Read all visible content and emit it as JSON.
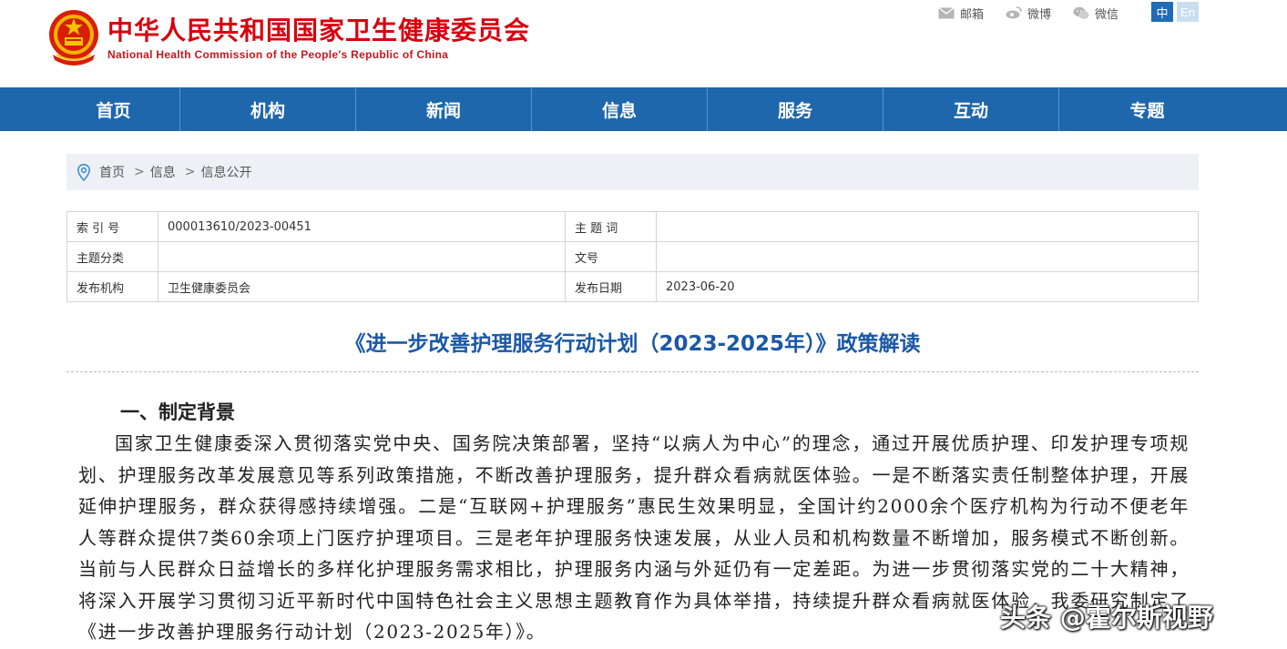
{
  "header": {
    "site_name_cn": "中华人民共和国国家卫生健康委员会",
    "site_name_en": "National Health Commission of the People′s Republic of China",
    "links": [
      {
        "label": "邮箱",
        "icon": "mail-icon"
      },
      {
        "label": "微博",
        "icon": "weibo-icon"
      },
      {
        "label": "微信",
        "icon": "wechat-icon"
      }
    ],
    "lang": {
      "zh": "中",
      "en": "En"
    }
  },
  "nav": [
    "首页",
    "机构",
    "新闻",
    "信息",
    "服务",
    "互动",
    "专题"
  ],
  "breadcrumb": {
    "items": [
      "首页",
      "信息",
      "信息公开"
    ],
    "separator": ">"
  },
  "meta": {
    "index_label": "索 引 号",
    "index_value": "000013610/2023-00451",
    "keywords_label": "主 题 词",
    "keywords_value": "",
    "category_label": "主题分类",
    "category_value": "",
    "docnum_label": "文号",
    "docnum_value": "",
    "publisher_label": "发布机构",
    "publisher_value": "卫生健康委员会",
    "date_label": "发布日期",
    "date_value": "2023-06-20"
  },
  "article": {
    "title": "《进一步改善护理服务行动计划（2023-2025年）》政策解读",
    "section_heading": "一、制定背景",
    "paragraph": "国家卫生健康委深入贯彻落实党中央、国务院决策部署，坚持“以病人为中心”的理念，通过开展优质护理、印发护理专项规划、护理服务改革发展意见等系列政策措施，不断改善护理服务，提升群众看病就医体验。一是不断落实责任制整体护理，开展延伸护理服务，群众获得感持续增强。二是“互联网+护理服务”惠民生效果明显，全国计约2000余个医疗机构为行动不便老年人等群众提供7类60余项上门医疗护理项目。三是老年护理服务快速发展，从业人员和机构数量不断增加，服务模式不断创新。当前与人民群众日益增长的多样化护理服务需求相比，护理服务内涵与外延仍有一定差距。为进一步贯彻落实党的二十大精神，将深入开展学习贯彻习近平新时代中国特色社会主义思想主题教育作为具体举措，持续提升群众看病就医体验，我委研究制定了《进一步改善护理服务行动计划（2023-2025年）》。"
  },
  "watermark": "头条 @霍尔斯视野",
  "colors": {
    "nav_bg": "#1f67ac",
    "title_blue": "#1b58a6",
    "brand_red": "#d7000f"
  }
}
